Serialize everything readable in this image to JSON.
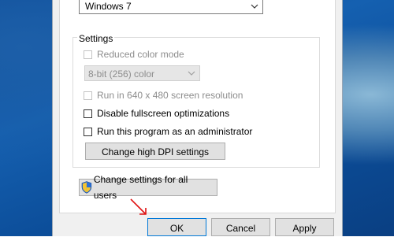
{
  "compatibility_mode": {
    "selected": "Windows 7"
  },
  "settings": {
    "legend": "Settings",
    "reduced_color_mode": "Reduced color mode",
    "color_select": "8-bit (256) color",
    "run_640": "Run in 640 x 480 screen resolution",
    "disable_fullscreen": "Disable fullscreen optimizations",
    "run_admin": "Run this program as an administrator",
    "change_dpi": "Change high DPI settings"
  },
  "change_all_users": "Change settings for all users",
  "buttons": {
    "ok": "OK",
    "cancel": "Cancel",
    "apply": "Apply"
  },
  "icons": {
    "shield": "uac-shield-icon",
    "pointer": "red-arrow-pointer-icon"
  }
}
